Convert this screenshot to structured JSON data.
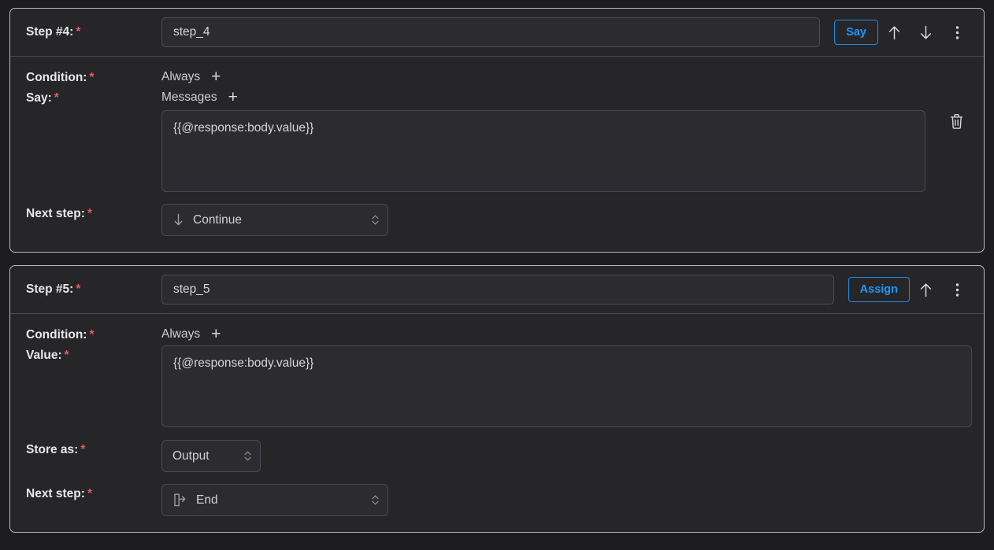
{
  "theme": {
    "page_bg": "#1d1d21",
    "card_bg": "#262629",
    "card_border": "#b9b9b9",
    "field_bg": "#2c2c30",
    "accent_blue": "#2196f3",
    "required_red": "#e05c5c",
    "text_primary": "#e8e8e8",
    "text_secondary": "#cfcfcf"
  },
  "steps": [
    {
      "header": {
        "label": "Step #4:",
        "required_marker": "*",
        "name_value": "step_4",
        "name_placeholder": "step_4",
        "type_button": "Say",
        "move_up_icon": "arrow-up-icon",
        "move_down_icon": "arrow-down-icon",
        "more_icon": "kebab-menu-icon"
      },
      "condition": {
        "label": "Condition:",
        "required_marker": "*",
        "value": "Always",
        "add_label": "+"
      },
      "say": {
        "label": "Say:",
        "required_marker": "*",
        "value": "Messages",
        "add_label": "+",
        "message_text": "{{@response:body.value}}",
        "message_placeholder": "",
        "delete_icon": "trash-icon"
      },
      "next_step": {
        "label": "Next step:",
        "required_marker": "*",
        "selected": "Continue",
        "icon": "arrow-down-icon"
      }
    },
    {
      "header": {
        "label": "Step #5:",
        "required_marker": "*",
        "name_value": "step_5",
        "name_placeholder": "step_5",
        "type_button": "Assign",
        "move_up_icon": "arrow-up-icon",
        "more_icon": "kebab-menu-icon"
      },
      "condition": {
        "label": "Condition:",
        "required_marker": "*",
        "value": "Always",
        "add_label": "+"
      },
      "value_field": {
        "label": "Value:",
        "required_marker": "*",
        "text": "{{@response:body.value}}",
        "placeholder": ""
      },
      "store_as": {
        "label": "Store as:",
        "required_marker": "*",
        "selected": "Output"
      },
      "next_step": {
        "label": "Next step:",
        "required_marker": "*",
        "selected": "End",
        "icon": "exit-door-icon"
      }
    }
  ]
}
